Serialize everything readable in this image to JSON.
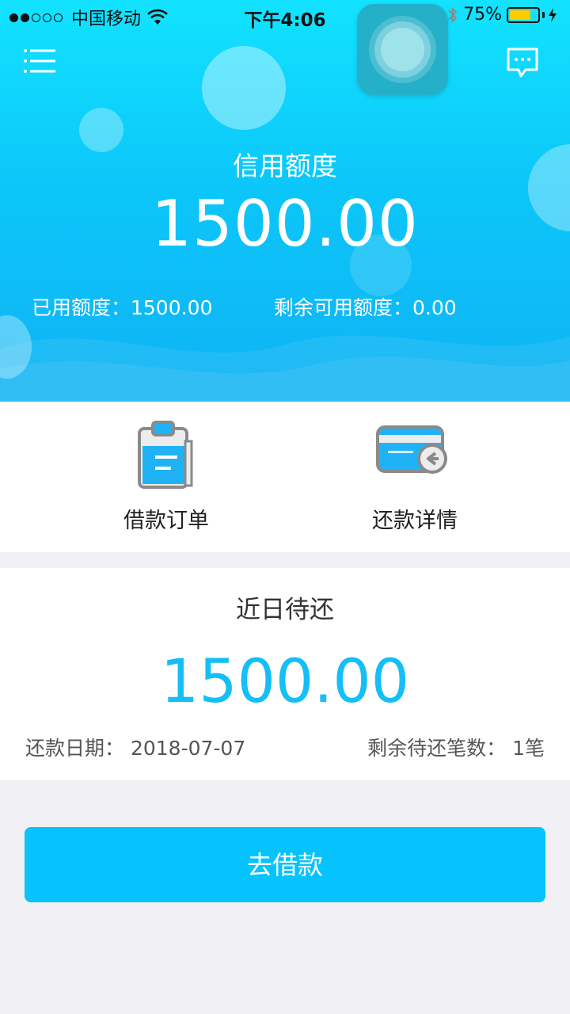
{
  "status_bar": {
    "carrier": "中国移动",
    "time": "下午4:06",
    "battery": "75%",
    "battery_level": 0.75
  },
  "header": {
    "menu_icon": "list-menu-icon",
    "message_icon": "message-bubble-icon",
    "credit_label": "信用额度",
    "credit_amount": "1500.00",
    "used_text": "已用额度：1500.00",
    "remaining_text": "剩余可用额度：0.00"
  },
  "actions": {
    "loan_orders": {
      "label": "借款订单",
      "icon": "clipboard-icon"
    },
    "repayment_details": {
      "label": "还款详情",
      "icon": "card-return-icon"
    }
  },
  "repayment": {
    "title": "近日待还",
    "amount": "1500.00",
    "date_text": "还款日期： 2018-07-07",
    "count_text": "剩余待还笔数：  1笔"
  },
  "cta": {
    "label": "去借款"
  },
  "colors": {
    "accent": "#06c3fd",
    "amount_blue": "#13bff6",
    "battery_yellow": "#ffcc00"
  }
}
